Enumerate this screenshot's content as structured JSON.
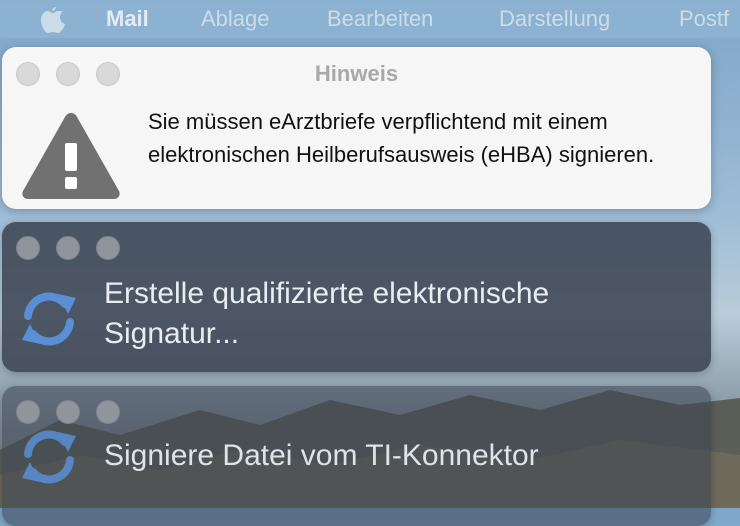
{
  "menubar": {
    "apple_icon": "apple-logo-icon",
    "app_name": "Mail",
    "items": [
      "Ablage",
      "Bearbeiten",
      "Darstellung",
      "Postf"
    ]
  },
  "alert": {
    "title": "Hinweis",
    "icon": "warning-icon",
    "message": "Sie müssen eArztbriefe verpflichtend mit einem elektronischen Heilberufsausweis (eHBA) signieren."
  },
  "progress_windows": [
    {
      "icon": "sync-icon",
      "text": "Erstelle qualifizierte elektronische Signatur..."
    },
    {
      "icon": "sync-icon",
      "text": "Signiere Datei vom TI-Konnektor"
    }
  ],
  "colors": {
    "accent_icon": "#5a8fd6",
    "alert_bg": "#f6f6f6",
    "progress_bg": "#3a4250"
  }
}
